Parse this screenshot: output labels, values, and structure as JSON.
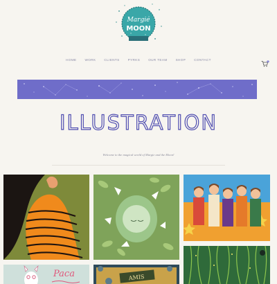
{
  "brand": {
    "logo_top_text": "Margie",
    "logo_bottom_text": "MOON"
  },
  "nav": {
    "items": [
      "HOME",
      "WORK",
      "CLIENTS",
      "PYRKS",
      "OUR TEAM",
      "SHOP",
      "CONTACT"
    ]
  },
  "cart": {
    "icon": "shopping-cart-icon",
    "count": "0"
  },
  "page": {
    "title": "ILLUSTRATION",
    "welcome": "Welcome to the magical world of Margie and the Moon!"
  },
  "gallery": {
    "tile_paca_text": "Paca",
    "tile_amis_text": "AMIS"
  },
  "colors": {
    "background": "#f7f5f0",
    "accent": "#6f6dc9",
    "title_stroke": "#4f4db0",
    "nav_text": "#8a8aa6"
  }
}
